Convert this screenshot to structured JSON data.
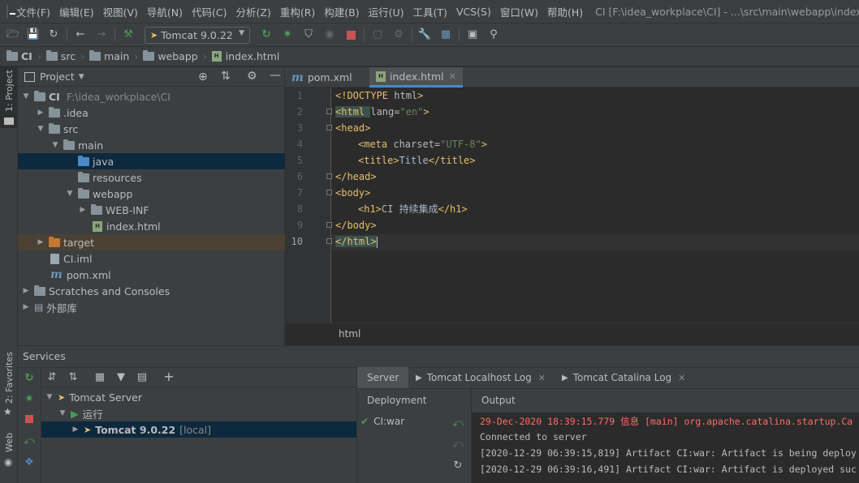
{
  "colors": {
    "accent": "#4a88c7",
    "green": "#499c54",
    "red": "#c75450",
    "error_text": "#ff6b68"
  },
  "menu": {
    "items": [
      "文件(F)",
      "编辑(E)",
      "视图(V)",
      "导航(N)",
      "代码(C)",
      "分析(Z)",
      "重构(R)",
      "构建(B)",
      "运行(U)",
      "工具(T)",
      "VCS(S)",
      "窗口(W)",
      "帮助(H)"
    ],
    "window_title": "CI [F:\\idea_workplace\\CI] - ...\\src\\main\\webapp\\index.html"
  },
  "toolbar": {
    "run_config": "Tomcat 9.0.22"
  },
  "breadcrumb": [
    "CI",
    "src",
    "main",
    "webapp",
    "index.html"
  ],
  "left_stripe": {
    "project": "1: Project",
    "favorites": "2: Favorites",
    "web": "Web"
  },
  "project": {
    "title": "Project",
    "tree": [
      {
        "label": "CI",
        "extra": "F:\\idea_workplace\\CI"
      },
      {
        "label": ".idea"
      },
      {
        "label": "src"
      },
      {
        "label": "main"
      },
      {
        "label": "java"
      },
      {
        "label": "resources"
      },
      {
        "label": "webapp"
      },
      {
        "label": "WEB-INF"
      },
      {
        "label": "index.html"
      },
      {
        "label": "target"
      },
      {
        "label": "CI.iml"
      },
      {
        "label": "pom.xml"
      },
      {
        "label": "Scratches and Consoles"
      },
      {
        "label": "外部库"
      }
    ]
  },
  "editor": {
    "tabs": [
      "pom.xml",
      "index.html"
    ],
    "line_numbers": [
      "1",
      "2",
      "3",
      "4",
      "5",
      "6",
      "7",
      "8",
      "9",
      "10"
    ],
    "lines": [
      {
        "t1": "<!DOCTYPE ",
        "t2": "html",
        "t3": ">"
      },
      {
        "tag": "<html ",
        "attr": "lang=",
        "str": "\"en\"",
        "close": ">"
      },
      {
        "tag": "<head>"
      },
      {
        "tag": "<meta ",
        "attr": "charset=",
        "str": "\"UTF-8\"",
        "close": ">"
      },
      {
        "tag": "<title>",
        "text": "Title",
        "close": "</title>"
      },
      {
        "tag": "</head>"
      },
      {
        "tag": "<body>"
      },
      {
        "tag": "<h1>",
        "text": "CI 持续集成",
        "close": "</h1>"
      },
      {
        "tag": "</body>"
      },
      {
        "tag": "</html>"
      }
    ],
    "breadcrumb": "html"
  },
  "services": {
    "title": "Services",
    "tree": [
      {
        "label": "Tomcat Server"
      },
      {
        "label": "运行"
      },
      {
        "label": "Tomcat 9.0.22",
        "extra": "[local]"
      }
    ],
    "tabs": [
      "Server",
      "Tomcat Localhost Log",
      "Tomcat Catalina Log"
    ],
    "deployment_header": "Deployment",
    "output_header": "Output",
    "deployment_item": "CI:war",
    "output_lines": [
      "29-Dec-2020 18:39:15.779 信息 [main] org.apache.catalina.startup.Ca",
      "Connected to server",
      "[2020-12-29 06:39:15,819] Artifact CI:war: Artifact is being deploy",
      "[2020-12-29 06:39:16,491] Artifact CI:war: Artifact is deployed suc"
    ]
  }
}
